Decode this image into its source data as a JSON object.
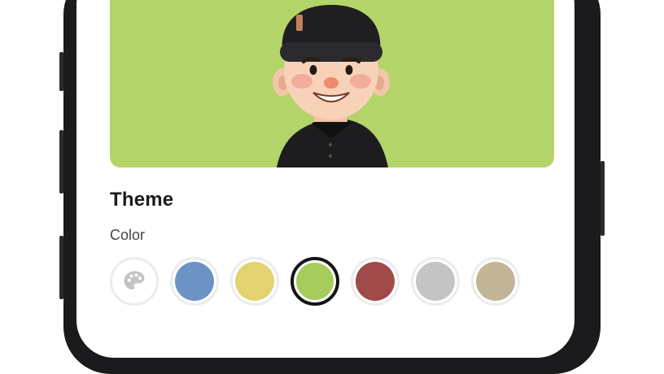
{
  "theme": {
    "title": "Theme",
    "color_label": "Color",
    "swatches": [
      {
        "name": "custom-palette",
        "icon": "palette-icon",
        "color": "#c4c4c4",
        "selected": false
      },
      {
        "name": "blue",
        "color": "#6b93c4",
        "selected": false
      },
      {
        "name": "yellow",
        "color": "#e3d370",
        "selected": false
      },
      {
        "name": "green",
        "color": "#a6cd5c",
        "selected": true
      },
      {
        "name": "red",
        "color": "#a14a4a",
        "selected": false
      },
      {
        "name": "gray",
        "color": "#c4c4c4",
        "selected": false
      },
      {
        "name": "beige",
        "color": "#c2b597",
        "selected": false
      }
    ]
  },
  "hero": {
    "background": "#b3d468",
    "avatar": "3d-avatar-beanie-black-shirt"
  }
}
